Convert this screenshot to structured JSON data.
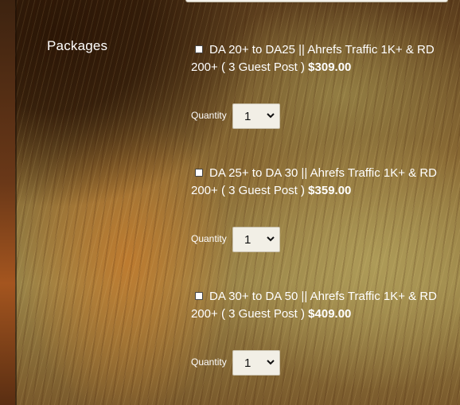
{
  "packages_label": "Packages",
  "packages": [
    {
      "title": "DA 20+ to DA25 || Ahrefs Traffic 1K+ & RD 200+ ( 3 Guest Post )",
      "price": "$309.00",
      "quantity_label": "Quantity",
      "quantity_value": "1"
    },
    {
      "title": "DA 25+ to DA 30 || Ahrefs Traffic 1K+ & RD 200+ ( 3 Guest Post )",
      "price": "$359.00",
      "quantity_label": "Quantity",
      "quantity_value": "1"
    },
    {
      "title": "DA 30+ to DA 50 || Ahrefs Traffic 1K+ & RD 200+ ( 3 Guest Post )",
      "price": "$409.00",
      "quantity_label": "Quantity",
      "quantity_value": "1"
    }
  ],
  "colors": {
    "label_text": "#ffffff",
    "select_bg": "#f2efe6"
  }
}
